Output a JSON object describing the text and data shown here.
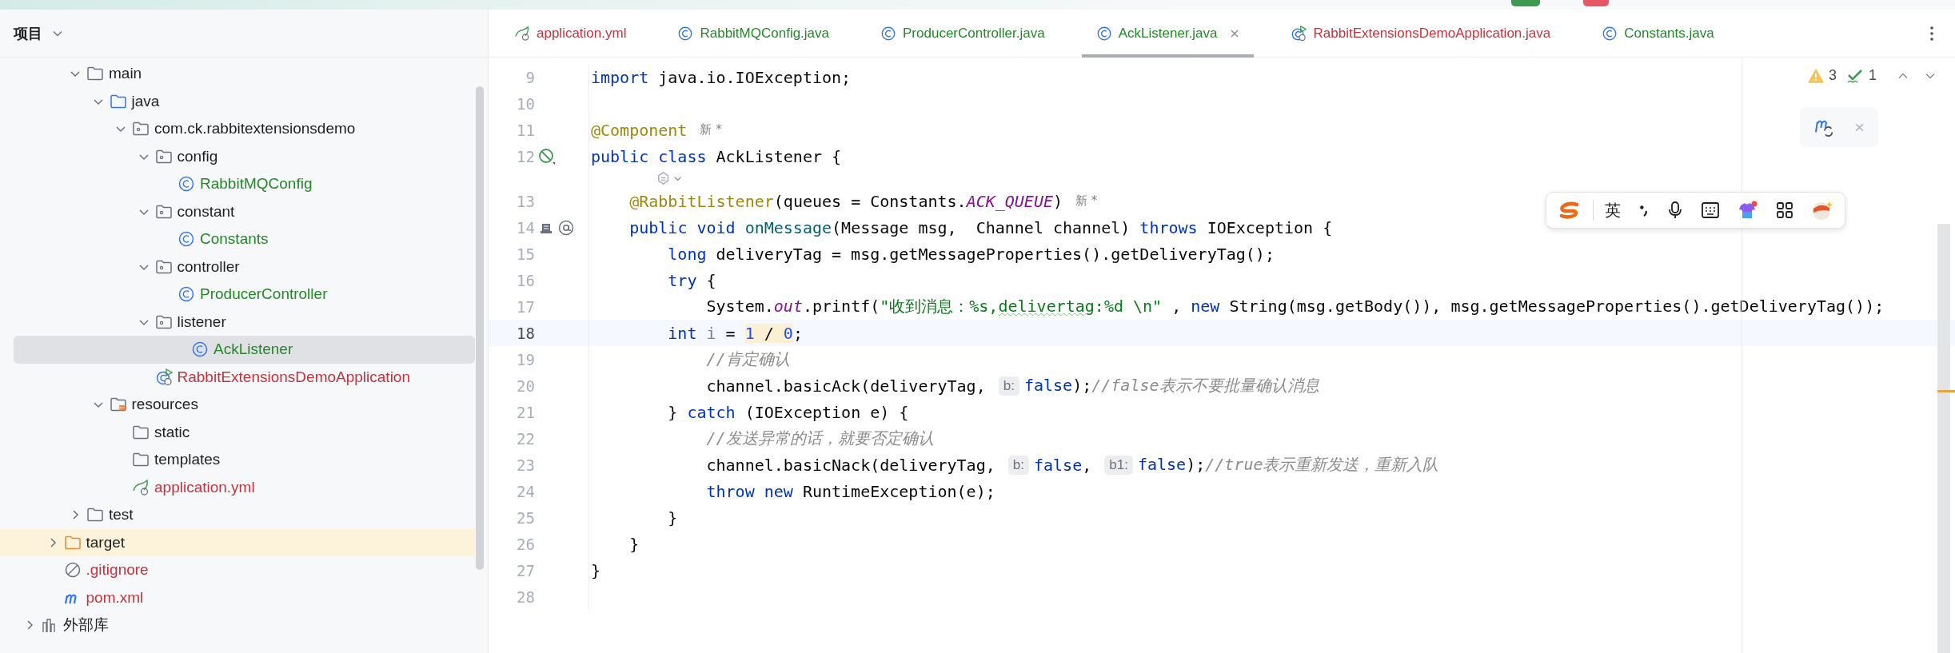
{
  "sidebar": {
    "title": "项目",
    "tree": [
      {
        "label": "main",
        "kind": "folder",
        "expanded": true,
        "selected": false,
        "children": [
          {
            "label": "java",
            "kind": "source_root",
            "expanded": true,
            "selected": false,
            "children": [
              {
                "label": "com.ck.rabbitextensionsdemo",
                "kind": "package",
                "expanded": true,
                "selected": false,
                "children": [
                  {
                    "label": "config",
                    "kind": "package",
                    "expanded": true,
                    "selected": false,
                    "children": [
                      {
                        "label": "RabbitMQConfig",
                        "kind": "class",
                        "color": "#25862a",
                        "selected": false
                      }
                    ]
                  },
                  {
                    "label": "constant",
                    "kind": "package",
                    "expanded": true,
                    "selected": false,
                    "children": [
                      {
                        "label": "Constants",
                        "kind": "class",
                        "color": "#25862a",
                        "selected": false
                      }
                    ]
                  },
                  {
                    "label": "controller",
                    "kind": "package",
                    "expanded": true,
                    "selected": false,
                    "children": [
                      {
                        "label": "ProducerController",
                        "kind": "class",
                        "color": "#25862a",
                        "selected": false
                      }
                    ]
                  },
                  {
                    "label": "listener",
                    "kind": "package",
                    "expanded": true,
                    "selected": false,
                    "children": [
                      {
                        "label": "AckListener",
                        "kind": "class",
                        "color": "#25862a",
                        "selected": true
                      }
                    ]
                  },
                  {
                    "label": "RabbitExtensionsDemoApplication",
                    "kind": "spring_boot",
                    "color": "#c4333d",
                    "selected": false
                  }
                ]
              }
            ]
          },
          {
            "label": "resources",
            "kind": "resources_root",
            "expanded": true,
            "selected": false,
            "children": [
              {
                "label": "static",
                "kind": "folder",
                "selected": false
              },
              {
                "label": "templates",
                "kind": "folder",
                "selected": false
              },
              {
                "label": "application.yml",
                "kind": "spring_yml",
                "color": "#c4333d",
                "selected": false
              }
            ]
          }
        ]
      },
      {
        "label": "test",
        "kind": "folder",
        "expanded": false,
        "selected": false
      }
    ],
    "project_files": [
      {
        "label": "target",
        "kind": "excluded",
        "expanded": false,
        "highlighted": true,
        "selected": false
      },
      {
        "label": ".gitignore",
        "kind": "gitignore",
        "color": "#c4333d",
        "selected": false
      },
      {
        "label": "pom.xml",
        "kind": "maven",
        "color": "#c4333d",
        "selected": false
      }
    ],
    "libraries": [
      {
        "label": "外部库",
        "kind": "library",
        "expanded": false,
        "selected": false
      }
    ]
  },
  "tabs": [
    {
      "label": "application.yml",
      "kind": "spring_yml",
      "color": "#c4333d",
      "selected": false
    },
    {
      "label": "RabbitMQConfig.java",
      "kind": "class",
      "color": "#25862a",
      "selected": false
    },
    {
      "label": "ProducerController.java",
      "kind": "class",
      "color": "#25862a",
      "selected": false
    },
    {
      "label": "AckListener.java",
      "kind": "class",
      "color": "#25862a",
      "selected": true
    },
    {
      "label": "RabbitExtensionsDemoApplication.java",
      "kind": "spring_boot",
      "color": "#c4333d",
      "selected": false
    },
    {
      "label": "Constants.java",
      "kind": "class",
      "color": "#25862a",
      "selected": false
    }
  ],
  "inspections": {
    "warnings": "3",
    "weak_warnings": "1"
  },
  "ime_toolbar": {
    "mode": "英"
  },
  "code_lines": [
    {
      "kind": "code",
      "number": "9",
      "tokens": [
        {
          "kind": "kw",
          "text": "import"
        },
        {
          "kind": "plain",
          "text": " java.io.IOException;"
        }
      ]
    },
    {
      "kind": "code",
      "number": "10"
    },
    {
      "kind": "code",
      "number": "11",
      "tokens": [
        {
          "kind": "ann",
          "text": "@Component"
        },
        {
          "kind": "author",
          "text": "新 *"
        }
      ]
    },
    {
      "kind": "code",
      "number": "12",
      "gutter_icons": [
        {
          "kind": "bean"
        }
      ],
      "tokens": [
        {
          "kind": "kw",
          "text": "public class"
        },
        {
          "kind": "plain",
          "text": " AckListener {"
        }
      ]
    },
    {
      "kind": "lens"
    },
    {
      "kind": "code",
      "number": "13",
      "tokens": [
        {
          "kind": "ann",
          "text": "    @RabbitListener"
        },
        {
          "kind": "plain",
          "text": "(queues = Constants."
        },
        {
          "kind": "static",
          "text": "ACK_QUEUE"
        },
        {
          "kind": "plain",
          "text": ")"
        },
        {
          "kind": "author",
          "text": "新 *"
        }
      ]
    },
    {
      "kind": "code",
      "number": "14",
      "gutter_icons": [
        {
          "kind": "queue"
        },
        {
          "kind": "at"
        }
      ],
      "tokens": [
        {
          "kind": "kw",
          "text": "    public void"
        },
        {
          "kind": "fn",
          "text": " onMessage"
        },
        {
          "kind": "plain",
          "text": "(Message msg,  Channel channel) "
        },
        {
          "kind": "kw",
          "text": "throws"
        },
        {
          "kind": "plain",
          "text": " IOException {"
        }
      ]
    },
    {
      "kind": "code",
      "number": "15",
      "tokens": [
        {
          "kind": "kw",
          "text": "        long"
        },
        {
          "kind": "plain",
          "text": " deliveryTag = msg.getMessageProperties().getDeliveryTag();"
        }
      ]
    },
    {
      "kind": "code",
      "number": "16",
      "tokens": [
        {
          "kind": "kw",
          "text": "        try"
        },
        {
          "kind": "plain",
          "text": " {"
        }
      ]
    },
    {
      "kind": "code",
      "number": "17",
      "tokens": [
        {
          "kind": "plain",
          "text": "            System."
        },
        {
          "kind": "static",
          "text": "out"
        },
        {
          "kind": "plain",
          "text": ".printf("
        },
        {
          "kind": "str",
          "text": "\"收到消息：%s,"
        },
        {
          "kind": "str",
          "text": "delivertag",
          "typo": true
        },
        {
          "kind": "str",
          "text": ":%d \\n\""
        },
        {
          "kind": "plain",
          "text": " , "
        },
        {
          "kind": "kw",
          "text": "new"
        },
        {
          "kind": "plain",
          "text": " String(msg.getBody()), msg.getMessageProperties().getDeliveryTag());"
        }
      ]
    },
    {
      "kind": "code",
      "number": "18",
      "current": true,
      "tokens": [
        {
          "kind": "kw",
          "text": "        int"
        },
        {
          "kind": "unused",
          "text": " i"
        },
        {
          "kind": "plain",
          "text": " = "
        },
        {
          "kind": "num",
          "text": "1",
          "marked": true
        },
        {
          "kind": "plain",
          "text": " / ",
          "marked": true
        },
        {
          "kind": "num",
          "text": "0",
          "marked": true
        },
        {
          "kind": "plain",
          "text": ";"
        }
      ]
    },
    {
      "kind": "code",
      "number": "19",
      "tokens": [
        {
          "kind": "comment",
          "text": "            //肯定确认"
        }
      ]
    },
    {
      "kind": "code",
      "number": "20",
      "tokens": [
        {
          "kind": "plain",
          "text": "            channel.basicAck(deliveryTag, "
        },
        {
          "kind": "hint",
          "text": "b:"
        },
        {
          "kind": "kw",
          "text": "false"
        },
        {
          "kind": "plain",
          "text": ");"
        },
        {
          "kind": "comment",
          "text": "//false表示不要批量确认消息"
        }
      ]
    },
    {
      "kind": "code",
      "number": "21",
      "tokens": [
        {
          "kind": "plain",
          "text": "        } "
        },
        {
          "kind": "kw",
          "text": "catch"
        },
        {
          "kind": "plain",
          "text": " (IOException e) {"
        }
      ]
    },
    {
      "kind": "code",
      "number": "22",
      "tokens": [
        {
          "kind": "comment",
          "text": "            //发送异常的话，就要否定确认"
        }
      ]
    },
    {
      "kind": "code",
      "number": "23",
      "tokens": [
        {
          "kind": "plain",
          "text": "            channel.basicNack(deliveryTag, "
        },
        {
          "kind": "hint",
          "text": "b:"
        },
        {
          "kind": "kw",
          "text": "false"
        },
        {
          "kind": "plain",
          "text": ", "
        },
        {
          "kind": "hint",
          "text": "b1:"
        },
        {
          "kind": "kw",
          "text": "false"
        },
        {
          "kind": "plain",
          "text": ");"
        },
        {
          "kind": "comment",
          "text": "//true表示重新发送，重新入队"
        }
      ]
    },
    {
      "kind": "code",
      "number": "24",
      "tokens": [
        {
          "kind": "kw",
          "text": "            throw new"
        },
        {
          "kind": "plain",
          "text": " RuntimeException(e);"
        }
      ]
    },
    {
      "kind": "code",
      "number": "25",
      "tokens": [
        {
          "kind": "plain",
          "text": "        }"
        }
      ]
    },
    {
      "kind": "code",
      "number": "26",
      "tokens": [
        {
          "kind": "plain",
          "text": "    }"
        }
      ]
    },
    {
      "kind": "code",
      "number": "27",
      "tokens": [
        {
          "kind": "plain",
          "text": "}"
        }
      ]
    },
    {
      "kind": "code",
      "number": "28"
    }
  ]
}
